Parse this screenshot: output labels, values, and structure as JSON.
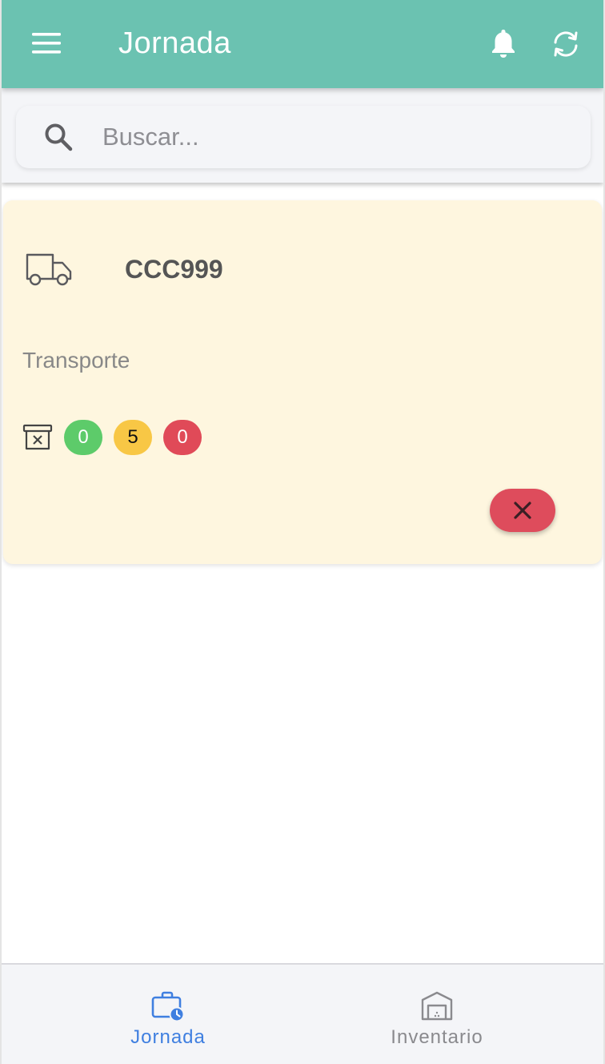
{
  "toolbar": {
    "title": "Jornada",
    "icons": [
      "menu-icon",
      "bell-icon",
      "sync-icon"
    ]
  },
  "search": {
    "placeholder": "Buscar...",
    "value": ""
  },
  "card": {
    "plate": "CCC999",
    "type": "Transporte",
    "counts": {
      "green": "0",
      "yellow": "5",
      "red": "0"
    },
    "colors": {
      "background": "#fef6df",
      "green": "#5dcb6a",
      "yellow": "#f8c745",
      "red": "#e04a58"
    }
  },
  "tabs": [
    {
      "label": "Jornada",
      "icon": "briefcase-clock-icon",
      "active": true
    },
    {
      "label": "Inventario",
      "icon": "warehouse-icon",
      "active": false
    }
  ],
  "theme": {
    "primary": "#6bc2b1",
    "active_tab": "#3f7fe0",
    "inactive_tab": "#8a8a8e"
  }
}
